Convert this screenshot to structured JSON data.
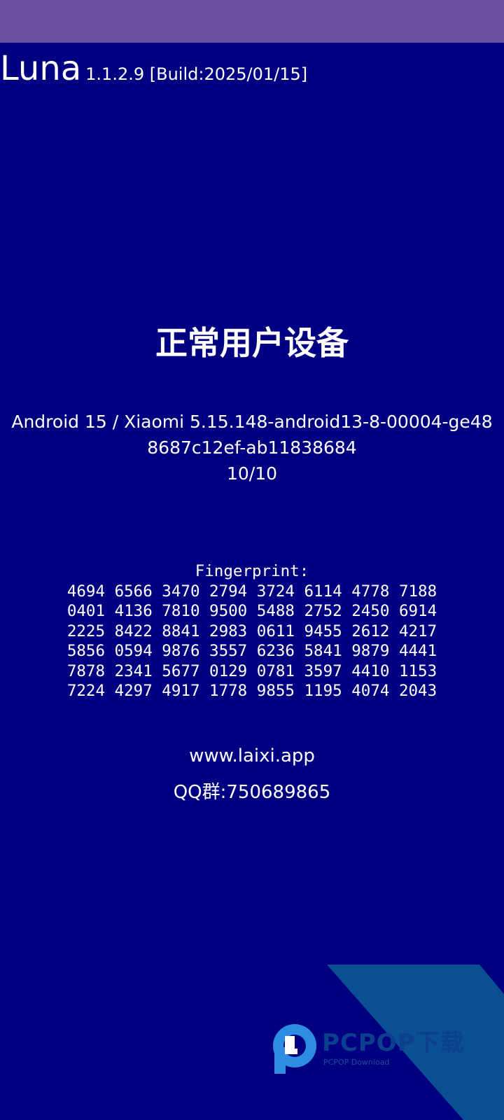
{
  "header": {
    "app_name": "Luna",
    "version": "1.1.2.9 [Build:2025/01/15]"
  },
  "device": {
    "status": "正常用户设备",
    "info_lines": [
      "Android 15 / Xiaomi 5.15.148-android13-8-00004-ge48",
      "8687c12ef-ab11838684",
      "10/10"
    ]
  },
  "fingerprint": {
    "label": "Fingerprint:",
    "rows": [
      "4694 6566 3470 2794 3724 6114 4778 7188",
      "0401 4136 7810 9500 5488 2752 2450 6914",
      "2225 8422 8841 2983 0611 9455 2612 4217",
      "5856 0594 9876 3557 6236 5841 9879 4441",
      "7878 2341 5677 0129 0781 3597 4410 1153",
      "7224 4297 4917 1778 9855 1195 4074 2043"
    ]
  },
  "links": {
    "website": "www.laixi.app",
    "qq_group": "QQ群:750689865"
  },
  "watermark": {
    "brand": "PCPOP下载",
    "subtitle": "PCPOP Download",
    "icon": "pcpop-logo-icon"
  },
  "colors": {
    "background": "#000080",
    "status_bar": "#6a4fa3",
    "text": "#ffffff",
    "watermark_panel": "#0b4f93",
    "watermark_logo": "#2d8de0"
  }
}
